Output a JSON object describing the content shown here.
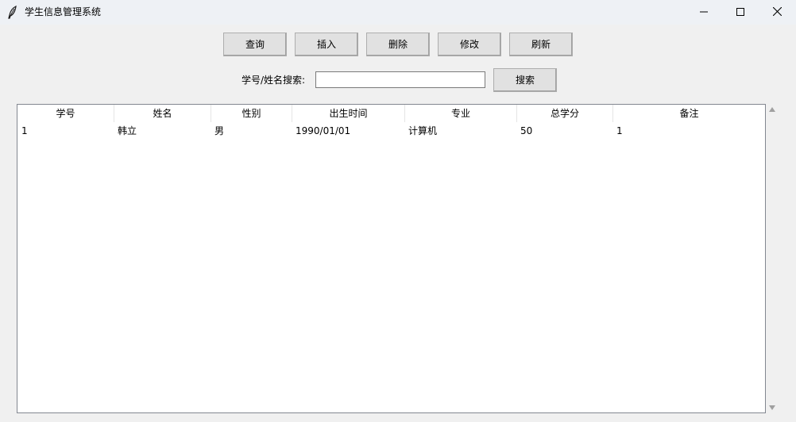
{
  "window": {
    "title": "学生信息管理系统"
  },
  "toolbar": {
    "buttons": [
      {
        "label": "查询"
      },
      {
        "label": "插入"
      },
      {
        "label": "删除"
      },
      {
        "label": "修改"
      },
      {
        "label": "刷新"
      }
    ]
  },
  "search": {
    "label": "学号/姓名搜索:",
    "value": "",
    "placeholder": "",
    "button_label": "搜索"
  },
  "table": {
    "columns": [
      "学号",
      "姓名",
      "性别",
      "出生时间",
      "专业",
      "总学分",
      "备注"
    ],
    "rows": [
      [
        "1",
        "韩立",
        "男",
        "1990/01/01",
        "计算机",
        "50",
        "1"
      ]
    ]
  },
  "icons": {
    "app": "feather-icon",
    "minimize": "minimize-icon",
    "maximize": "maximize-icon",
    "close": "close-icon",
    "scroll_up": "scroll-up-arrow-icon",
    "scroll_down": "scroll-down-arrow-icon"
  }
}
